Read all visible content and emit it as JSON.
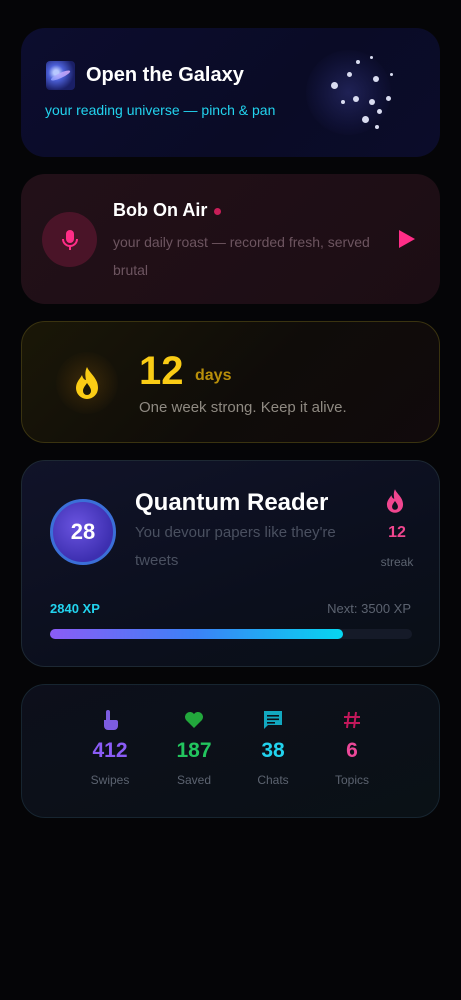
{
  "galaxy": {
    "title": "Open the Galaxy",
    "subtitle": "your reading universe — pinch & pan",
    "icon": "milky-way-emoji"
  },
  "podcast": {
    "title": "Bob On Air",
    "subtitle": "your daily roast — recorded fresh, served brutal",
    "icon": "mic-icon",
    "accent": "#ff2d87"
  },
  "streak_card": {
    "count": "12",
    "unit": "days",
    "message": "One week strong. Keep it alive.",
    "accent": "#facc15"
  },
  "profile": {
    "level": "28",
    "title": "Quantum Reader",
    "subtitle": "You devour papers like they're tweets",
    "streak_count": "12",
    "streak_label": "streak",
    "xp_current": "2840 XP",
    "xp_next": "Next: 3500 XP",
    "xp_progress": 0.81
  },
  "stats": [
    {
      "icon": "swipe-hand-icon",
      "value": "412",
      "label": "Swipes",
      "color": "#8b5cf6"
    },
    {
      "icon": "heart-icon",
      "value": "187",
      "label": "Saved",
      "color": "#22c55e"
    },
    {
      "icon": "chat-icon",
      "value": "38",
      "label": "Chats",
      "color": "#22d3ee"
    },
    {
      "icon": "hash-icon",
      "value": "6",
      "label": "Topics",
      "color": "#ec4899"
    }
  ]
}
